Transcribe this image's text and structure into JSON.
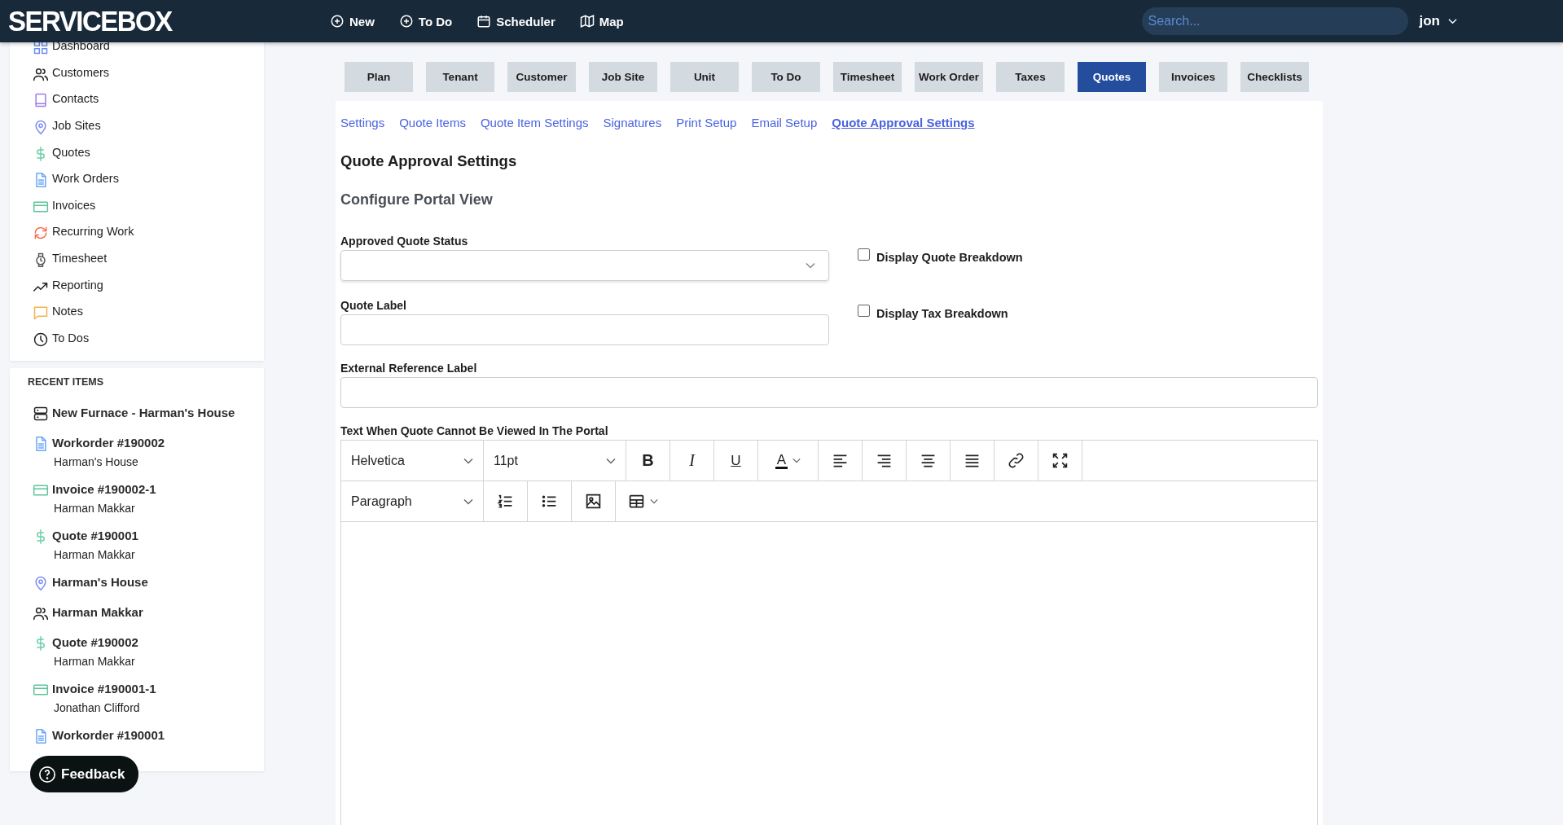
{
  "header": {
    "logo": "SERVICEBOX",
    "actions": [
      {
        "label": "New",
        "kind": "plus"
      },
      {
        "label": "To Do",
        "kind": "plus"
      },
      {
        "label": "Scheduler",
        "kind": "calendar"
      },
      {
        "label": "Map",
        "kind": "map"
      }
    ],
    "search": {
      "placeholder": "Search..."
    },
    "user": "jon"
  },
  "sidebar": {
    "items": [
      {
        "label": "Dashboard",
        "kind": "grid"
      },
      {
        "label": "Customers",
        "kind": "people"
      },
      {
        "label": "Contacts",
        "kind": "book"
      },
      {
        "label": "Job Sites",
        "kind": "pin"
      },
      {
        "label": "Quotes",
        "kind": "dollar"
      },
      {
        "label": "Work Orders",
        "kind": "doc"
      },
      {
        "label": "Invoices",
        "kind": "card"
      },
      {
        "label": "Recurring Work",
        "kind": "cycle"
      },
      {
        "label": "Timesheet",
        "kind": "watch"
      },
      {
        "label": "Reporting",
        "kind": "trend"
      },
      {
        "label": "Notes",
        "kind": "chat"
      },
      {
        "label": "To Dos",
        "kind": "clock"
      }
    ]
  },
  "recent": {
    "title": "RECENT ITEMS",
    "items": [
      {
        "title": "New Furnace - Harman's House",
        "kind": "server"
      },
      {
        "title": "Workorder #190002",
        "subtitle": "Harman's House",
        "kind": "doc"
      },
      {
        "title": "Invoice #190002-1",
        "subtitle": "Harman Makkar",
        "kind": "card"
      },
      {
        "title": "Quote #190001",
        "subtitle": "Harman Makkar",
        "kind": "dollar"
      },
      {
        "title": "Harman's House",
        "kind": "pin"
      },
      {
        "title": "Harman Makkar",
        "kind": "people"
      },
      {
        "title": "Quote #190002",
        "subtitle": "Harman Makkar",
        "kind": "dollar"
      },
      {
        "title": "Invoice #190001-1",
        "subtitle": "Jonathan Clifford",
        "kind": "card"
      },
      {
        "title": "Workorder #190001",
        "kind": "doc"
      }
    ]
  },
  "feedback": {
    "label": "Feedback"
  },
  "tabs": [
    {
      "label": "Plan",
      "selected": false
    },
    {
      "label": "Tenant",
      "selected": false
    },
    {
      "label": "Customer",
      "selected": false
    },
    {
      "label": "Job Site",
      "selected": false
    },
    {
      "label": "Unit",
      "selected": false
    },
    {
      "label": "To Do",
      "selected": false
    },
    {
      "label": "Timesheet",
      "selected": false
    },
    {
      "label": "Work Order",
      "selected": false
    },
    {
      "label": "Taxes",
      "selected": false
    },
    {
      "label": "Quotes",
      "selected": true
    },
    {
      "label": "Invoices",
      "selected": false
    },
    {
      "label": "Checklists",
      "selected": false
    }
  ],
  "subtabs": [
    {
      "label": "Settings",
      "selected": false
    },
    {
      "label": "Quote Items",
      "selected": false
    },
    {
      "label": "Quote Item Settings",
      "selected": false
    },
    {
      "label": "Signatures",
      "selected": false
    },
    {
      "label": "Print Setup",
      "selected": false
    },
    {
      "label": "Email Setup",
      "selected": false
    },
    {
      "label": "Quote Approval Settings",
      "selected": true
    }
  ],
  "page_title": "Quote Approval Settings",
  "section_title": "Configure Portal View",
  "approved_quote_status": {
    "label": "Approved Quote Status"
  },
  "quote_label": {
    "label": "Quote Label"
  },
  "checkboxes": [
    {
      "label": "Display Quote Breakdown",
      "checked": false
    },
    {
      "label": "Display Tax Breakdown",
      "checked": false
    }
  ],
  "external_reference_label": {
    "label": "External Reference Label"
  },
  "editor": {
    "label": "Text When Quote Cannot Be Viewed In The Portal",
    "font": "Helvetica",
    "size": "11pt",
    "block": "Paragraph",
    "row1": [
      {
        "kind": "bold",
        "label": "B"
      },
      {
        "kind": "italic",
        "label": "I"
      },
      {
        "kind": "underline",
        "label": "U"
      },
      {
        "kind": "text-color",
        "label": "A"
      },
      {
        "kind": "align-left"
      },
      {
        "kind": "align-right"
      },
      {
        "kind": "align-center"
      },
      {
        "kind": "justify"
      },
      {
        "kind": "link"
      },
      {
        "kind": "fullscreen"
      }
    ],
    "row2": [
      {
        "kind": "numbered-list"
      },
      {
        "kind": "bullet-list"
      },
      {
        "kind": "image"
      },
      {
        "kind": "table"
      }
    ]
  }
}
